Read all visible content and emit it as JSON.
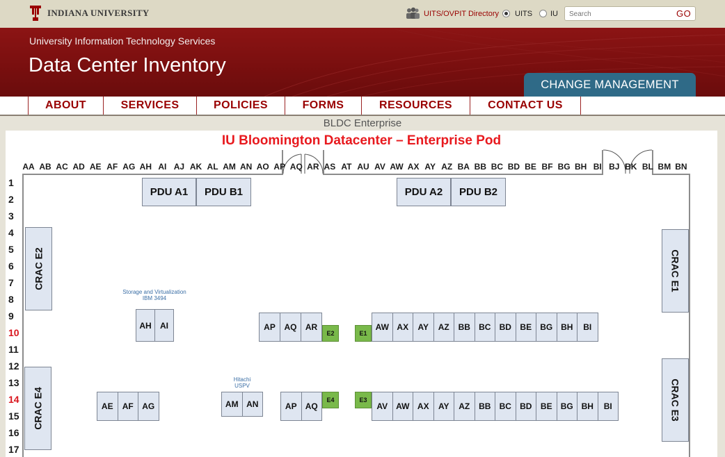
{
  "header": {
    "university": "INDIANA UNIVERSITY",
    "directory_link": "UITS/OVPIT Directory",
    "radio_options": [
      {
        "label": "UITS",
        "checked": true
      },
      {
        "label": "IU",
        "checked": false
      }
    ],
    "search_placeholder": "Search",
    "search_button": "GO"
  },
  "banner": {
    "subtitle": "University Information Technology Services",
    "title": "Data Center Inventory",
    "change_management": "CHANGE MANAGEMENT"
  },
  "nav": [
    "ABOUT",
    "SERVICES",
    "POLICIES",
    "FORMS",
    "RESOURCES",
    "CONTACT US"
  ],
  "breadcrumb": "BLDC Enterprise",
  "floorplan": {
    "title": "IU Bloomington Datacenter – Enterprise Pod",
    "columns": [
      "AA",
      "AB",
      "AC",
      "AD",
      "AE",
      "AF",
      "AG",
      "AH",
      "AI",
      "AJ",
      "AK",
      "AL",
      "AM",
      "AN",
      "AO",
      "AP",
      "AQ",
      "AR",
      "AS",
      "AT",
      "AU",
      "AV",
      "AW",
      "AX",
      "AY",
      "AZ",
      "BA",
      "BB",
      "BC",
      "BD",
      "BE",
      "BF",
      "BG",
      "BH",
      "BI",
      "BJ",
      "BK",
      "BL",
      "BM",
      "BN"
    ],
    "rows": [
      "1",
      "2",
      "3",
      "4",
      "5",
      "6",
      "7",
      "8",
      "9",
      "10",
      "11",
      "12",
      "13",
      "14",
      "15",
      "16",
      "17"
    ],
    "highlighted_rows": [
      "10",
      "14"
    ],
    "pdus": [
      "PDU A1",
      "PDU B1",
      "PDU A2",
      "PDU B2"
    ],
    "cracs": [
      "CRAC E2",
      "CRAC E1",
      "CRAC E4",
      "CRAC E3"
    ],
    "annotations": {
      "storage": [
        "Storage and Virtualization",
        "IBM 3494"
      ],
      "hitachi": [
        "Hitachi",
        "USPV"
      ]
    },
    "row10": {
      "storage_racks": [
        "AH",
        "AI"
      ],
      "left_racks": [
        "AP",
        "AQ",
        "AR"
      ],
      "green_left": "E2",
      "green_right": "E1",
      "right_racks": [
        "AW",
        "AX",
        "AY",
        "AZ",
        "BB",
        "BC",
        "BD",
        "BE",
        "BG",
        "BH",
        "BI"
      ]
    },
    "row14": {
      "left_racks": [
        "AE",
        "AF",
        "AG"
      ],
      "hitachi_racks": [
        "AM",
        "AN"
      ],
      "mid_racks": [
        "AP",
        "AQ"
      ],
      "green_left": "E4",
      "green_right": "E3",
      "right_racks": [
        "AV",
        "AW",
        "AX",
        "AY",
        "AZ",
        "BB",
        "BC",
        "BD",
        "BE",
        "BG",
        "BH",
        "BI"
      ]
    }
  },
  "colors": {
    "brand": "#990000",
    "banner": "#7d1010",
    "change_tab": "#2f6a87",
    "title_red": "#e8191e",
    "rack_fill": "#dfe6f1",
    "green_unit": "#79b94a"
  }
}
